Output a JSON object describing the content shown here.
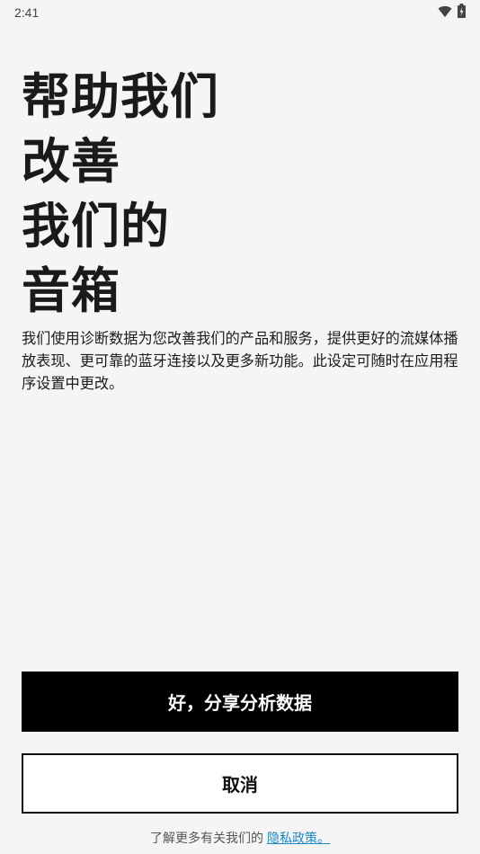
{
  "status_bar": {
    "time": "2:41",
    "icons": [
      "wifi-icon",
      "battery-charging-icon"
    ]
  },
  "headline": {
    "lines": [
      "帮助我们",
      "改善",
      "我们的",
      "音箱"
    ]
  },
  "description": "我们使用诊断数据为您改善我们的产品和服务，提供更好的流媒体播放表现、更可靠的蓝牙连接以及更多新功能。此设定可随时在应用程序设置中更改。",
  "buttons": {
    "primary_label": "好，分享分析数据",
    "secondary_label": "取消"
  },
  "footer": {
    "text": "了解更多有关我们的",
    "link_text": "隐私政策。"
  },
  "colors": {
    "background": "#f5f5f5",
    "primary_button": "#000000",
    "link": "#1e88c8"
  }
}
